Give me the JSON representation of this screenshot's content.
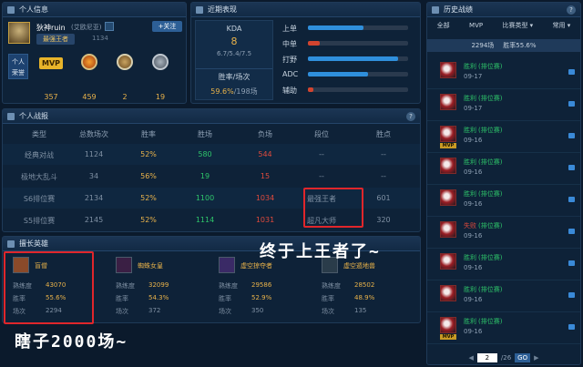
{
  "profile": {
    "header": "个人信息",
    "name": "狄神ruin",
    "region": "(艾欧尼亚)",
    "follow": "+关注",
    "rank_badge": "最强王者",
    "id_hint": "1134",
    "honor_label": "个人荣誉",
    "mvp": "MVP",
    "counts": [
      "357",
      "459",
      "2",
      "19"
    ]
  },
  "recent": {
    "header": "近期表现",
    "kda_label": "KDA",
    "kda_value": "8",
    "kda_detail": "6.7/5.4/7.5",
    "winrate_label": "胜率/场次",
    "winrate_value": "59.6%",
    "winrate_games": "/198场",
    "roles": [
      {
        "label": "上单",
        "fill": 0.55,
        "color": "#2f8fdc"
      },
      {
        "label": "中单",
        "fill": 0.12,
        "color": "#d2442f"
      },
      {
        "label": "打野",
        "fill": 0.9,
        "color": "#2f8fdc"
      },
      {
        "label": "ADC",
        "fill": 0.6,
        "color": "#2f8fdc"
      },
      {
        "label": "辅助",
        "fill": 0.05,
        "color": "#d2442f"
      }
    ]
  },
  "stats": {
    "header": "个人战报",
    "columns": [
      "类型",
      "总数场次",
      "胜率",
      "胜场",
      "负场",
      "段位",
      "胜点"
    ],
    "rows": [
      {
        "type": "经典对战",
        "total": "1124",
        "rate": "52%",
        "win": "580",
        "lose": "544",
        "tier": "--",
        "pts": "--"
      },
      {
        "type": "极地大乱斗",
        "total": "34",
        "rate": "56%",
        "win": "19",
        "lose": "15",
        "tier": "--",
        "pts": "--"
      },
      {
        "type": "S6排位赛",
        "total": "2134",
        "rate": "52%",
        "win": "1100",
        "lose": "1034",
        "tier": "最强王者",
        "pts": "601"
      },
      {
        "type": "S5排位赛",
        "total": "2145",
        "rate": "52%",
        "win": "1114",
        "lose": "1031",
        "tier": "超凡大师",
        "pts": "320"
      }
    ]
  },
  "heroes": {
    "header": "擅长英雄",
    "labels": [
      "熟练度",
      "胜率",
      "场次"
    ],
    "list": [
      {
        "name": "盲僧",
        "prof": "43070",
        "rate": "55.6%",
        "games": "2294",
        "color": "#8a4a2a"
      },
      {
        "name": "蜘蛛女皇",
        "prof": "32099",
        "rate": "54.3%",
        "games": "372",
        "color": "#3a1f44"
      },
      {
        "name": "虚空掠夺者",
        "prof": "29586",
        "rate": "52.9%",
        "games": "350",
        "color": "#3a2a66"
      },
      {
        "name": "虚空遁地兽",
        "prof": "28502",
        "rate": "48.9%",
        "games": "135",
        "color": "#2a3c4a"
      }
    ]
  },
  "history": {
    "header": "历史战绩",
    "tabs": [
      "全部",
      "MVP",
      "比赛类型",
      "常用"
    ],
    "summary_games": "2294场",
    "summary_rate": "胜率55.6%",
    "entries": [
      {
        "result": "胜利",
        "type": "(排位赛)",
        "date": "09-17",
        "mvp": false,
        "loss": false
      },
      {
        "result": "胜利",
        "type": "(排位赛)",
        "date": "09-17",
        "mvp": false,
        "loss": false
      },
      {
        "result": "胜利",
        "type": "(排位赛)",
        "date": "09-16",
        "mvp": true,
        "loss": false
      },
      {
        "result": "胜利",
        "type": "(排位赛)",
        "date": "09-16",
        "mvp": false,
        "loss": false
      },
      {
        "result": "胜利",
        "type": "(排位赛)",
        "date": "09-16",
        "mvp": false,
        "loss": false
      },
      {
        "result": "失败",
        "type": "(排位赛)",
        "date": "09-16",
        "mvp": false,
        "loss": true
      },
      {
        "result": "胜利",
        "type": "(排位赛)",
        "date": "09-16",
        "mvp": false,
        "loss": false
      },
      {
        "result": "胜利",
        "type": "(排位赛)",
        "date": "09-16",
        "mvp": false,
        "loss": false
      },
      {
        "result": "胜利",
        "type": "(排位赛)",
        "date": "09-16",
        "mvp": true,
        "loss": false
      }
    ],
    "page": "2",
    "total_pages": "/26",
    "go": "GO"
  },
  "annotations": {
    "top": "终于上王者了~",
    "bottom": "瞎子2000场~"
  },
  "colors": {
    "win": "#2ec56a",
    "loss": "#e04a3c",
    "gold": "#e8b24a",
    "red_box": "#e0262b"
  }
}
